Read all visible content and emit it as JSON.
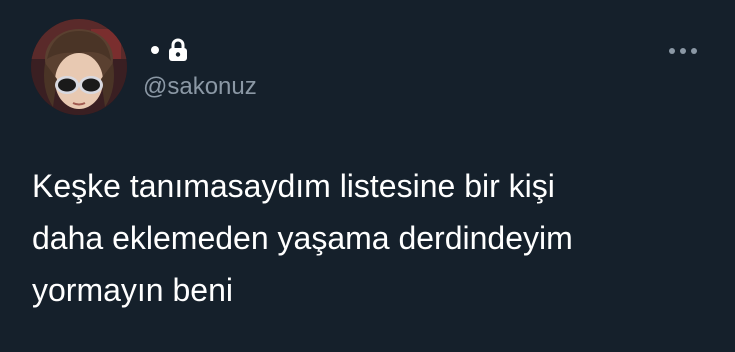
{
  "tweet": {
    "display_name": "",
    "handle": "@sakonuz",
    "text_lines": [
      "Keşke tanımasaydım listesine bir kişi",
      "daha eklemeden yaşama derdindeyim",
      "yormayın beni"
    ]
  },
  "icons": {
    "lock": "lock-icon",
    "more": "more-options-icon",
    "separator": "dot-icon"
  },
  "colors": {
    "background": "#15202b",
    "text": "#ffffff",
    "secondary_text": "#8b98a5"
  }
}
